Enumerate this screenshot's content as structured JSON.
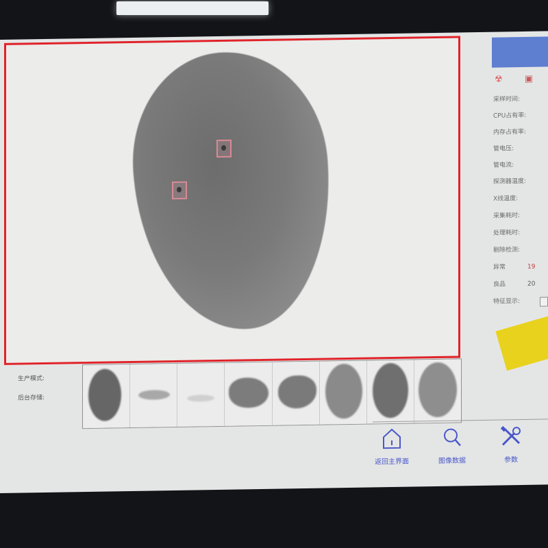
{
  "right_panel": {
    "stats": [
      {
        "label": "采样时间:",
        "value": ""
      },
      {
        "label": "CPU占有率:",
        "value": ""
      },
      {
        "label": "内存占有率:",
        "value": ""
      },
      {
        "label": "管电压:",
        "value": ""
      },
      {
        "label": "管电流:",
        "value": ""
      },
      {
        "label": "探测器温度:",
        "value": ""
      },
      {
        "label": "X线温度:",
        "value": ""
      },
      {
        "label": "采集耗时:",
        "value": ""
      },
      {
        "label": "处理耗时:",
        "value": ""
      },
      {
        "label": "剔除检测:",
        "value": ""
      },
      {
        "label": "异常",
        "value": "19"
      },
      {
        "label": "良品",
        "value": "20"
      },
      {
        "label": "特征显示:",
        "value": ""
      }
    ]
  },
  "options": {
    "production_mode_label": "生产模式:",
    "production_mode_checked": true,
    "background_storage_label": "后台存储:",
    "background_storage_checked": false
  },
  "nav": {
    "home_label": "返回主界面",
    "image_data_label": "图像数据",
    "params_label": "参数"
  },
  "icons": {
    "radiation": "radiation-icon",
    "robot": "robot-icon",
    "home": "home-icon",
    "search": "search-icon",
    "tools": "tools-icon"
  },
  "colors": {
    "view_border": "#e0232a",
    "defect_box": "#d88a96",
    "nav_text": "#4a57c8",
    "banner": "#5e7ed0",
    "check_mark": "#3fa34d"
  }
}
